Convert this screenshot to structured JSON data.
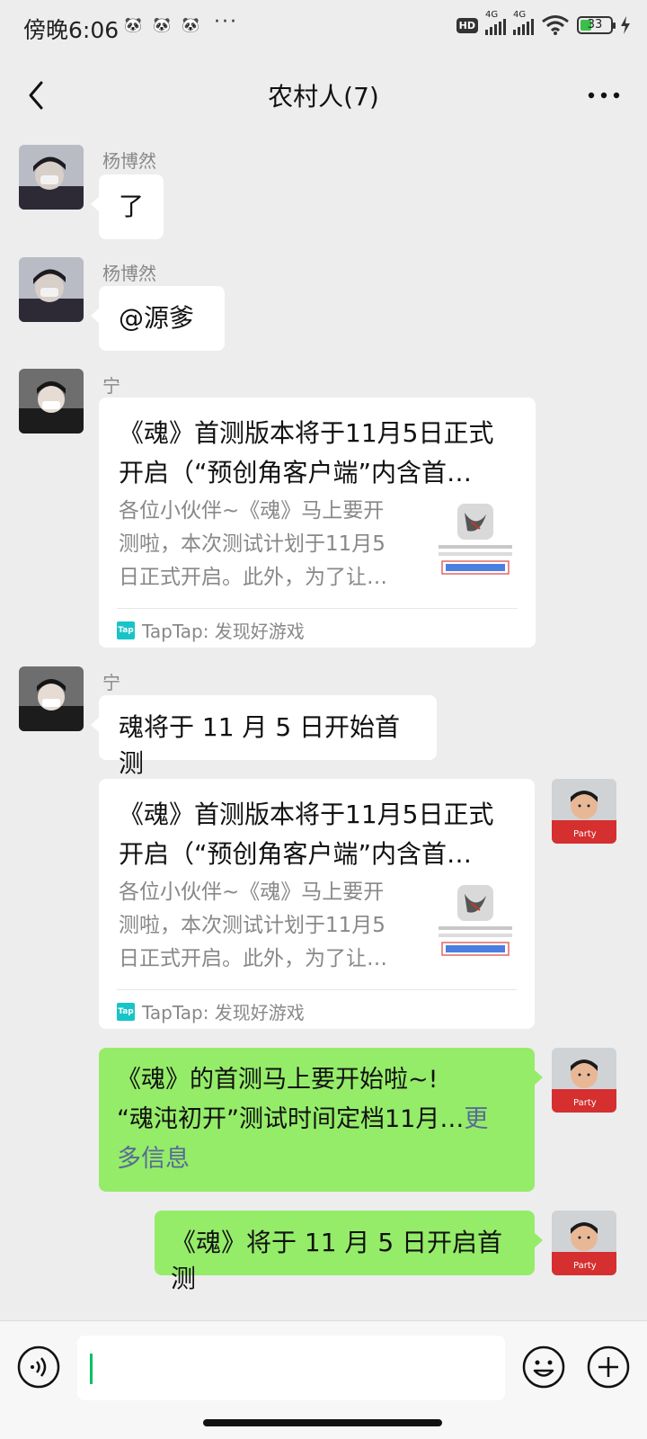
{
  "status_bar": {
    "time": "傍晚6:06",
    "dots": "···",
    "hd": "HD",
    "net1": "4G",
    "net2": "4G",
    "battery": "33"
  },
  "header": {
    "title": "农村人(7)"
  },
  "messages": [
    {
      "sender": "杨博然",
      "text": "了"
    },
    {
      "sender": "杨博然",
      "text": "@源爹"
    },
    {
      "sender": "宁",
      "card": {
        "title_line1": "《魂》首测版本将于11月5日正式",
        "title_line2": "开启（“预创角客户端”内含首…",
        "desc_line1": "各位小伙伴~《魂》马上要开",
        "desc_line2": "测啦，本次测试计划于11月5",
        "desc_line3": "日正式开启。此外，为了让…",
        "source": "TapTap: 发现好游戏"
      }
    },
    {
      "sender": "宁",
      "text": "魂将于 11 月 5 日开始首测"
    },
    {
      "card": {
        "title_line1": "《魂》首测版本将于11月5日正式",
        "title_line2": "开启（“预创角客户端”内含首…",
        "desc_line1": "各位小伙伴~《魂》马上要开",
        "desc_line2": "测啦，本次测试计划于11月5",
        "desc_line3": "日正式开启。此外，为了让…",
        "source": "TapTap: 发现好游戏"
      }
    },
    {
      "line1": "《魂》的首测马上要开始啦~!",
      "line2": "“魂沌初开”测试时间定档11月…",
      "more": "更",
      "line3": "多信息"
    },
    {
      "text": "《魂》将于 11 月 5 日开启首测"
    }
  ],
  "colors": {
    "background": "#ededed",
    "bubble_green": "#95ec69",
    "link": "#576b95",
    "accent": "#07c160"
  },
  "icons": {
    "back": "chevron-left-icon",
    "more": "more-icon",
    "voice": "voice-icon",
    "emoji": "emoji-icon",
    "plus": "plus-icon"
  }
}
